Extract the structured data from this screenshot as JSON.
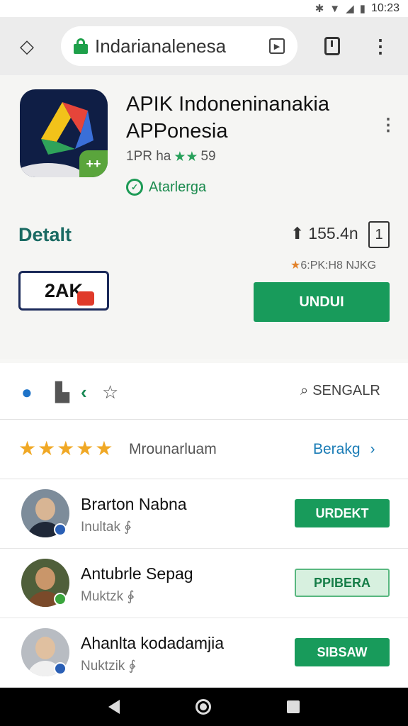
{
  "status": {
    "time": "10:23"
  },
  "browser": {
    "url": "Indarianalenesa",
    "url_action_icon": "play-icon"
  },
  "app": {
    "title": "APIK Indoneninanakia APPonesia",
    "meta_prefix": "1PR ha",
    "meta_stars": "★★",
    "meta_count": "59",
    "verified_label": "Atarlerga",
    "badge": "++"
  },
  "detail": {
    "label": "Detalt",
    "downloads": "155.4n",
    "rating_small": "6:PK:H8 NJKG",
    "dev_logo": "2AK",
    "install_label": "UNDUI"
  },
  "actions": {
    "search_label": "SENGALR"
  },
  "rating": {
    "stars": "★★★★★",
    "label": "Mrounarluam",
    "link": "Berakg"
  },
  "reviews": [
    {
      "name": "Brarton Nabna",
      "meta": "Inultak ∳",
      "button": "URDEKT",
      "style": "filled",
      "badge_color": "#2a5fb5"
    },
    {
      "name": "Antubrle Sepag",
      "meta": "Muktzk ∳",
      "button": "PPIBERA",
      "style": "outline",
      "badge_color": "#3aa53c"
    },
    {
      "name": "Ahanlta kodadamjia",
      "meta": "Nuktzik ∳",
      "button": "SIBSAW",
      "style": "filled",
      "badge_color": "#2a5fb5"
    }
  ]
}
